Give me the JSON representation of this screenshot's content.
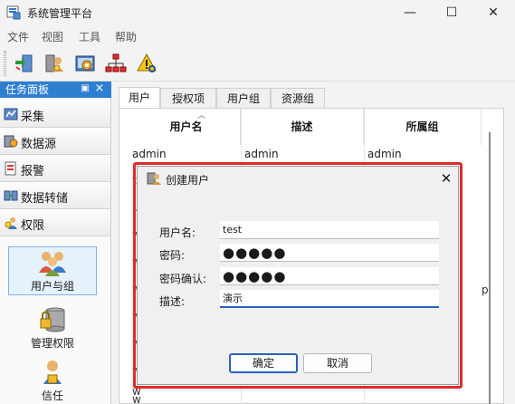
{
  "window": {
    "title": "系统管理平台",
    "minimize": "—",
    "maximize": "☐",
    "close": "✕"
  },
  "menu": [
    "文件",
    "视图",
    "工具",
    "帮助"
  ],
  "toolbar_icons": [
    "swap-icon",
    "user-gear-icon",
    "settings-gear-icon",
    "network-icon",
    "alert-search-icon"
  ],
  "task_panel": {
    "title": "任务面板",
    "pin": "▣",
    "close": "×",
    "items": [
      "采集",
      "数据源",
      "报警",
      "数据转储",
      "权限"
    ],
    "big_buttons": [
      "用户与组",
      "管理权限",
      "信任"
    ]
  },
  "tabs": [
    "用户",
    "授权项",
    "用户组",
    "资源组"
  ],
  "table": {
    "columns": [
      "用户名",
      "描述",
      "所属组"
    ],
    "first_row": [
      "admin",
      "admin",
      "admin"
    ],
    "clipped_left": [
      "te",
      "u",
      "w",
      "w",
      "w",
      "w",
      "w",
      "w",
      "w",
      "w"
    ],
    "clipped_right": "p"
  },
  "dialog": {
    "title": "创建用户",
    "close": "✕",
    "fields": [
      {
        "label": "用户名:",
        "value": "test"
      },
      {
        "label": "密码:",
        "value": "●●●●●"
      },
      {
        "label": "密码确认:",
        "value": "●●●●●"
      },
      {
        "label": "描述:",
        "value": "演示"
      }
    ],
    "ok": "确定",
    "cancel": "取消"
  },
  "colors": {
    "accent": "#2f7fd1",
    "highlight_border": "#e02a2a",
    "focus": "#2a62b8"
  }
}
